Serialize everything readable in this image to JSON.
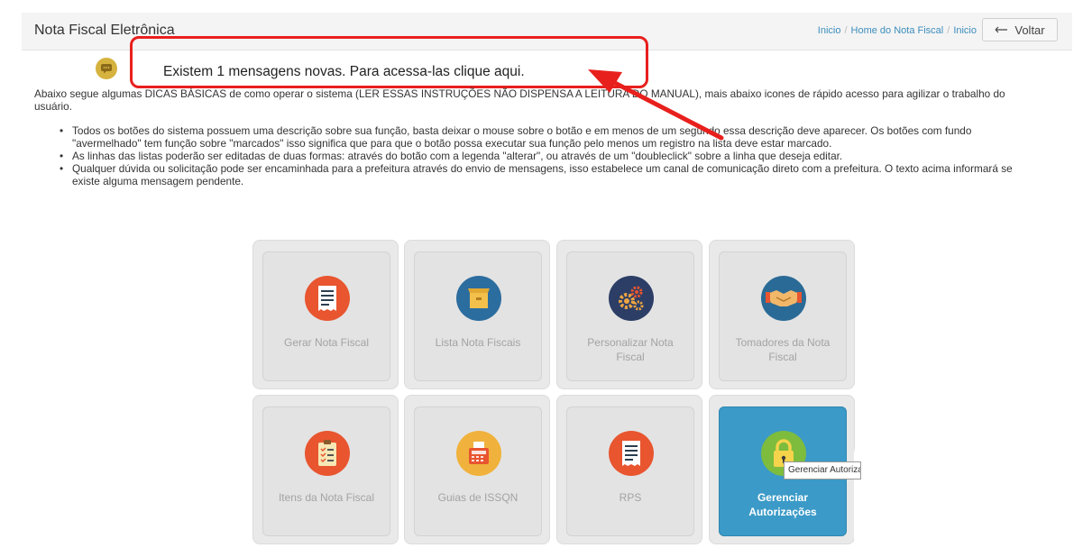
{
  "header": {
    "title": "Nota Fiscal Eletrônica",
    "breadcrumb": [
      "Inicio",
      "Home do Nota Fiscal",
      "Inicio"
    ],
    "back_button": "Voltar"
  },
  "messages": {
    "text": "Existem 1 mensagens novas. Para acessa-las clique aqui."
  },
  "intro": "Abaixo segue algumas DICAS BÁSICAS de como operar o sistema (LER ESSAS INSTRUÇÕES NÃO DISPENSA A LEITURA DO MANUAL), mais abaixo icones de rápido acesso para agilizar o trabalho do usuário.",
  "tips": [
    "Todos os botões do sistema possuem uma descrição sobre sua função, basta deixar o mouse sobre o botão e em menos de um segundo essa descrição deve aparecer. Os botões com fundo \"avermelhado\" tem função sobre \"marcados\" isso significa que para que o botão possa executar sua função pelo menos um registro na lista deve estar marcado.",
    "As linhas das listas poderão ser editadas de duas formas: através do botão com a legenda \"alterar\", ou através de um \"doubleclick\" sobre a linha que deseja editar.",
    "Qualquer dúvida ou solicitação pode ser encaminhada para a prefeitura através do envio de mensagens, isso estabelece um canal de comunicação direto com a prefeitura. O texto acima informará se existe alguma mensagem pendente."
  ],
  "tiles": [
    {
      "label": "Gerar Nota Fiscal",
      "icon": "invoice-icon",
      "color": "#e8552f"
    },
    {
      "label": "Lista Nota Fiscais",
      "icon": "box-icon",
      "color": "#2c6d9f"
    },
    {
      "label": "Personalizar Nota Fiscal",
      "icon": "gears-icon",
      "color": "#2c3e66"
    },
    {
      "label": "Tomadores da Nota Fiscal",
      "icon": "handshake-icon",
      "color": "#2a6a96"
    },
    {
      "label": "Itens da Nota Fiscal",
      "icon": "checklist-icon",
      "color": "#e8552f"
    },
    {
      "label": "Guias de ISSQN",
      "icon": "cash-register-icon",
      "color": "#f0b23c"
    },
    {
      "label": "RPS",
      "icon": "receipt-icon",
      "color": "#e8552f"
    },
    {
      "label": "Gerenciar Autorizações",
      "icon": "lock-icon",
      "color": "#7dbc3d"
    }
  ],
  "tooltip": "Gerenciar Autorizações",
  "colors": {
    "highlight": "#e8201d",
    "link": "#3c8dbc",
    "active_tile": "#3b9ac7"
  }
}
